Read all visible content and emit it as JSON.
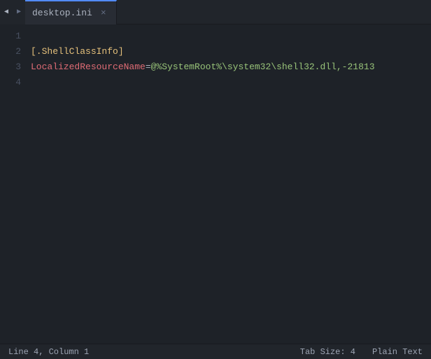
{
  "tabBar": {
    "prevBtn": "◀",
    "nextBtn": "▶",
    "tab": {
      "label": "desktop.ini",
      "closeIcon": "×"
    }
  },
  "editor": {
    "lines": [
      {
        "number": "1",
        "content": "",
        "type": "empty"
      },
      {
        "number": "2",
        "content": "[.ShellClassInfo]",
        "type": "bracket"
      },
      {
        "number": "3",
        "content": "LocalizedResourceName=@%SystemRoot%\\system32\\shell32.dll,-21813",
        "type": "keyvalue"
      },
      {
        "number": "4",
        "content": "",
        "type": "empty"
      }
    ]
  },
  "statusBar": {
    "position": "Line 4, Column 1",
    "tabSize": "Tab Size: 4",
    "language": "Plain Text"
  }
}
